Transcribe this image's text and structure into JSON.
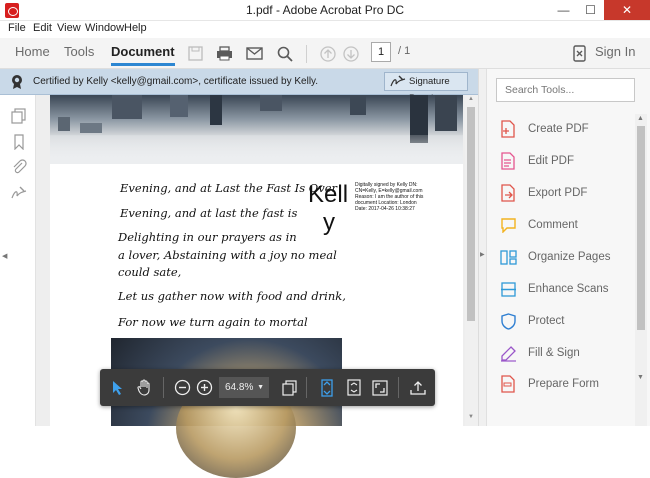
{
  "window": {
    "title": "1.pdf - Adobe Acrobat Pro DC",
    "min": "—",
    "max": "☐",
    "close": "✕"
  },
  "menu": [
    "File",
    "Edit",
    "View",
    "Window",
    "Help"
  ],
  "toolbar": {
    "nav": [
      "Home",
      "Tools",
      "Document"
    ],
    "active_nav": "Document",
    "page_current": "1",
    "page_total": "/ 1",
    "sign_in": "Sign In"
  },
  "cert_bar": {
    "text": "Certified by Kelly <kelly@gmail.com>, certificate issued by Kelly.",
    "button": "Signature Panel"
  },
  "document": {
    "lines": [
      "Evening, and at Last the Fast Is Over",
      "Evening, and at last the fast is",
      "Delighting in our prayers as in",
      "a lover, Abstaining with a joy no meal",
      "could sate,",
      "Let us gather now with food and drink,",
      "For now we turn again to mortal"
    ],
    "signature_name_1": "Kell",
    "signature_name_2": "y",
    "signature_details": "Digitally signed by Kelly DN: CN=Kelly, E=kelly@gmail.com Reason: I am the author of this document Location: London Date: 2017-04-26 10:38:27"
  },
  "float_toolbar": {
    "zoom": "64.8%"
  },
  "right_pane": {
    "search_placeholder": "Search Tools...",
    "tools": [
      {
        "label": "Create PDF",
        "icon": "create-pdf-icon",
        "color": "#e0564b"
      },
      {
        "label": "Edit PDF",
        "icon": "edit-pdf-icon",
        "color": "#e5568f"
      },
      {
        "label": "Export PDF",
        "icon": "export-pdf-icon",
        "color": "#e0564b"
      },
      {
        "label": "Comment",
        "icon": "comment-icon",
        "color": "#f2b320"
      },
      {
        "label": "Organize Pages",
        "icon": "organize-pages-icon",
        "color": "#2f9ad8"
      },
      {
        "label": "Enhance Scans",
        "icon": "enhance-scans-icon",
        "color": "#2f9ad8"
      },
      {
        "label": "Protect",
        "icon": "protect-icon",
        "color": "#2f7fd2"
      },
      {
        "label": "Fill & Sign",
        "icon": "fill-sign-icon",
        "color": "#9a56c9"
      },
      {
        "label": "Prepare Form",
        "icon": "prepare-form-icon",
        "color": "#e0564b"
      }
    ]
  },
  "colors": {
    "accent": "#2c86d2",
    "cert_bar": "#c9d9e8",
    "float_bar": "#3b3b3b"
  }
}
